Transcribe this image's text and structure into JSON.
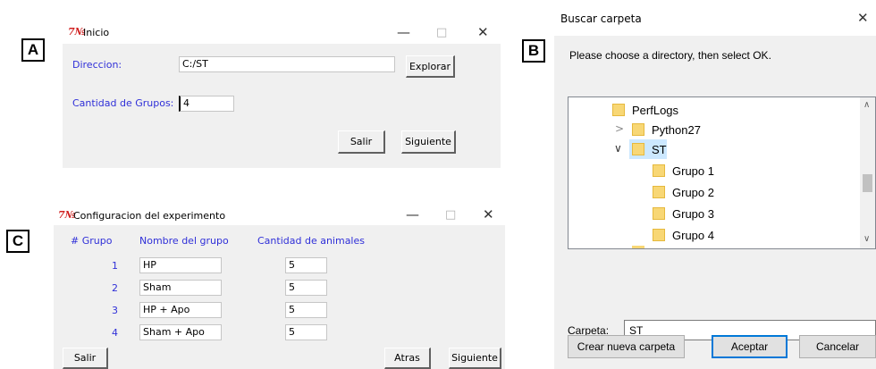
{
  "labels": {
    "a": "A",
    "b": "B",
    "c": "C"
  },
  "inicio": {
    "title": "Inicio",
    "tk_glyph": "7№",
    "direccion_label": "Direccion:",
    "direccion_value": "C:/ST",
    "explorar": "Explorar",
    "grupos_label": "Cantidad de Grupos:",
    "grupos_value": "4",
    "salir": "Salir",
    "siguiente": "Siguiente"
  },
  "buscar": {
    "title": "Buscar carpeta",
    "instructions": "Please choose a directory, then select OK.",
    "tree": [
      {
        "label": "PerfLogs",
        "expander": ""
      },
      {
        "label": "Python27",
        "expander": ">"
      },
      {
        "label": "ST",
        "expander": "∨"
      },
      {
        "label": "Grupo 1",
        "expander": ""
      },
      {
        "label": "Grupo 2",
        "expander": ""
      },
      {
        "label": "Grupo 3",
        "expander": ""
      },
      {
        "label": "Grupo 4",
        "expander": ""
      }
    ],
    "carpeta_label": "Carpeta:",
    "carpeta_value": "ST",
    "crear": "Crear nueva carpeta",
    "aceptar": "Aceptar",
    "cancelar": "Cancelar"
  },
  "config": {
    "title": "Configuracion del experimento",
    "headers": {
      "num": "# Grupo",
      "nombre": "Nombre del grupo",
      "cantidad": "Cantidad de animales"
    },
    "rows": [
      {
        "num": "1",
        "nombre": "HP",
        "cantidad": "5"
      },
      {
        "num": "2",
        "nombre": "Sham",
        "cantidad": "5"
      },
      {
        "num": "3",
        "nombre": "HP + Apo",
        "cantidad": "5"
      },
      {
        "num": "4",
        "nombre": "Sham + Apo",
        "cantidad": "5"
      }
    ],
    "salir": "Salir",
    "atras": "Atras",
    "siguiente": "Siguiente"
  },
  "window_controls": {
    "minimize": "—",
    "maximize": "□",
    "close": "✕"
  },
  "colors": {
    "label_blue": "#2f2fd8",
    "accent": "#0078d7",
    "folder": "#f8d775",
    "selected": "#cce8ff"
  }
}
